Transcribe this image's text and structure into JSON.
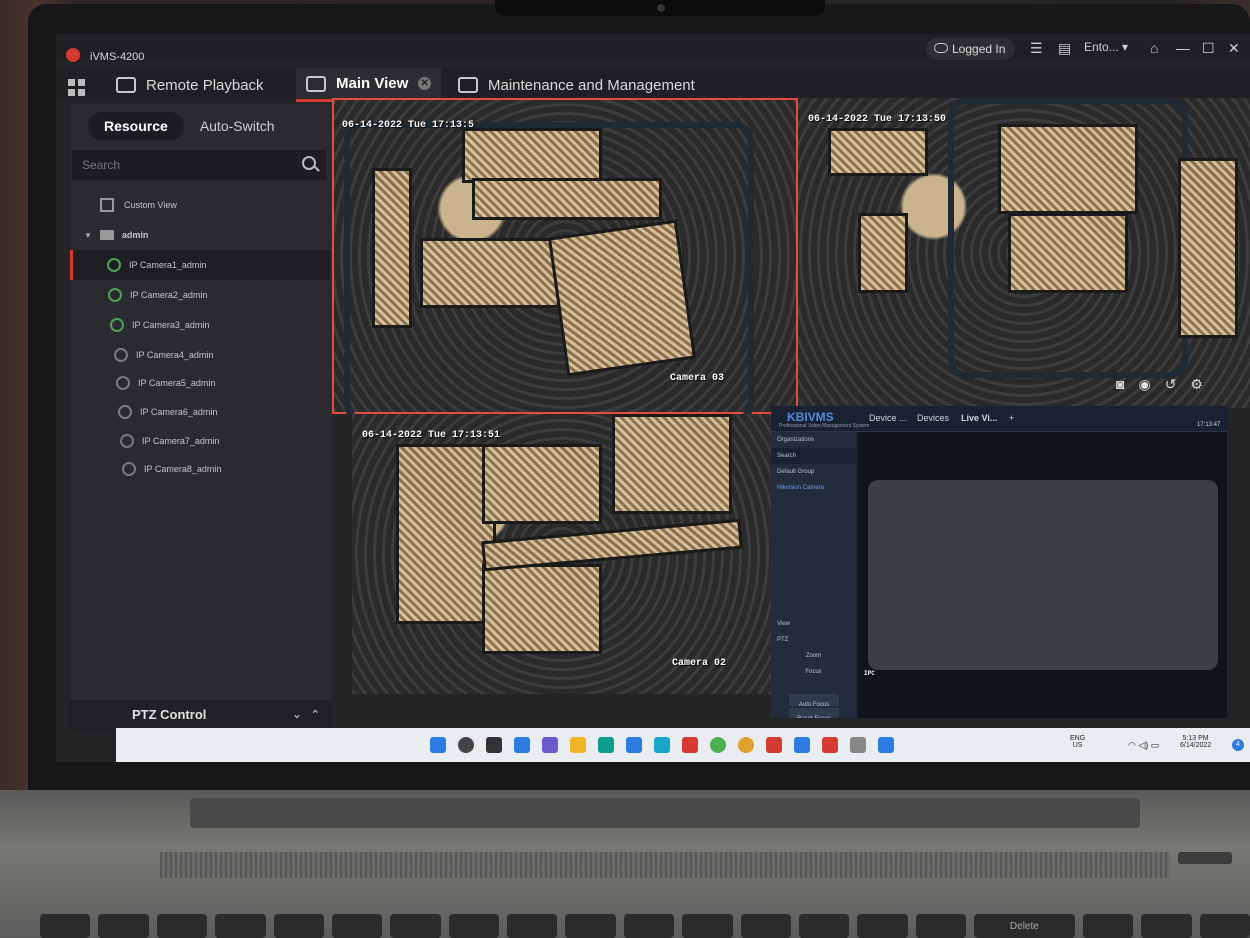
{
  "app": {
    "title": "iVMS-4200",
    "logged_in": "Logged In",
    "user": "Ento..."
  },
  "tabs": [
    {
      "label": "Remote Playback"
    },
    {
      "label": "Main View"
    },
    {
      "label": "Maintenance and Management"
    }
  ],
  "panel": {
    "seg_resource": "Resource",
    "seg_auto": "Auto-Switch",
    "search_placeholder": "Search",
    "custom_view": "Custom View",
    "group": "admin",
    "cameras": [
      "IP Camera1_admin",
      "IP Camera2_admin",
      "IP Camera3_admin",
      "IP Camera4_admin",
      "IP Camera5_admin",
      "IP Camera6_admin",
      "IP Camera7_admin",
      "IP Camera8_admin"
    ],
    "ptz": "PTZ Control"
  },
  "tiles": [
    {
      "timestamp": "06-14-2022 Tue 17:13:5",
      "name": "Camera 03"
    },
    {
      "timestamp": "06-14-2022 Tue 17:13:50",
      "name": ""
    },
    {
      "timestamp": "06-14-2022 Tue 17:13:51",
      "name": "Camera 02"
    }
  ],
  "kb": {
    "logo": "KBIVMS",
    "subtitle": "Professional Video Management System",
    "tabs": [
      "Device ...",
      "Devices",
      "Live Vi..."
    ],
    "plus": "+",
    "time": "17:13:47",
    "organizations": "Organizations",
    "search": "Search",
    "group": "Default Group",
    "camera": "Hikvision Camera",
    "view": "View",
    "ptz": "PTZ",
    "zoom": "Zoom",
    "focus": "Focus",
    "auto_focus": "Auto Focus",
    "reset_focus": "Reset Focus",
    "ipc": "IPC"
  },
  "taskbar": {
    "lang": "ENG",
    "region": "US",
    "time": "5:13 PM",
    "date": "6/14/2022",
    "badge": "4"
  },
  "keyboard": {
    "delete": "Delete"
  }
}
